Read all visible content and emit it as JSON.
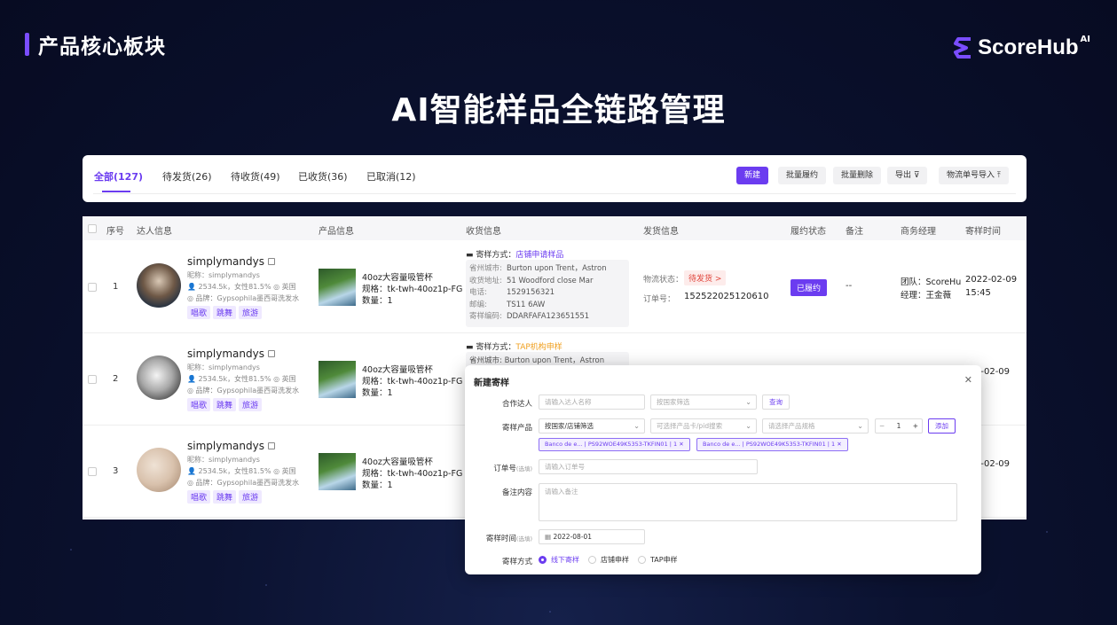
{
  "section_title": "产品核心板块",
  "brand": {
    "name": "ScoreHub",
    "ai": "AI",
    "accent": "#7a4dff"
  },
  "main_title": "AI智能样品全链路管理",
  "tabs": [
    {
      "label": "全部(127)",
      "active": true
    },
    {
      "label": "待发货(26)"
    },
    {
      "label": "待收货(49)"
    },
    {
      "label": "已收货(36)"
    },
    {
      "label": "已取消(12)"
    }
  ],
  "toolbar": {
    "new": "新建",
    "batch_fulfill": "批量履约",
    "batch_delete": "批量删除",
    "export": "导出",
    "import": "物流单号导入"
  },
  "columns": {
    "index": "序号",
    "influencer": "达人信息",
    "product": "产品信息",
    "receive": "收货信息",
    "ship": "发货信息",
    "status": "履约状态",
    "remark": "备注",
    "manager": "商务经理",
    "time": "寄样时间"
  },
  "rows": [
    {
      "index": "1",
      "name": "simplymandys",
      "nickname": "昵称：simplymandys",
      "stats": "2534.5k，女性81.5%",
      "country": "英国",
      "brand": "品牌：Gypsophila墨西哥洗发水",
      "tags": [
        "唱歌",
        "跳舞",
        "旅游"
      ],
      "product_name": "40oz大容量吸管杯",
      "product_spec": "规格：tk-twh-40oz1p-FG",
      "product_qty": "数量：1",
      "ship_method_label": "寄样方式：",
      "ship_method": "店铺申请样品",
      "address": [
        {
          "k": "省州城市:",
          "v": "Burton upon Trent，Astron"
        },
        {
          "k": "收货地址:",
          "v": "51 Woodford close Mar"
        },
        {
          "k": "电话:",
          "v": "1529156321"
        },
        {
          "k": "邮编:",
          "v": "TS11 6AW"
        },
        {
          "k": "寄样编码:",
          "v": "DDARFAFA123651551"
        }
      ],
      "logistics_label": "物流状态：",
      "logistics_status": "待发货 >",
      "order_label": "订单号：",
      "order_no": "152522025120610",
      "fulfill": "已履约",
      "remark": "--",
      "team": "团队：ScoreHu",
      "manager": "经理：王金薇",
      "date": "2022-02-09",
      "clock": "15:45"
    },
    {
      "index": "2",
      "name": "simplymandys",
      "nickname": "昵称：simplymandys",
      "stats": "2534.5k，女性81.5%",
      "country": "英国",
      "brand": "品牌：Gypsophila墨西哥洗发水",
      "tags": [
        "唱歌",
        "跳舞",
        "旅游"
      ],
      "product_name": "40oz大容量吸管杯",
      "product_spec": "规格：tk-twh-40oz1p-FG",
      "product_qty": "数量：1",
      "ship_method_label": "寄样方式：",
      "ship_method": "TAP机构申样",
      "address_first": "省州城市:  Burton upon Trent，Astron",
      "date": "2-02-09",
      "clock": "5"
    },
    {
      "index": "3",
      "name": "simplymandys",
      "nickname": "昵称：simplymandys",
      "stats": "2534.5k，女性81.5%",
      "country": "英国",
      "brand": "品牌：Gypsophila墨西哥洗发水",
      "tags": [
        "唱歌",
        "跳舞",
        "旅游"
      ],
      "product_name": "40oz大容量吸管杯",
      "product_spec": "规格：tk-twh-40oz1p-FG",
      "product_qty": "数量：1",
      "date": "2-02-09",
      "clock": "5"
    }
  ],
  "modal": {
    "title": "新建寄样",
    "partner_label": "合作达人",
    "partner_placeholder": "请输入达人名称",
    "country_placeholder": "按国家筛选",
    "query": "查询",
    "product_label": "寄样产品",
    "filter_value": "按国家/店铺筛选",
    "card_placeholder": "可选择产品卡/pid搜索",
    "spec_placeholder": "请选择产品规格",
    "qty": "1",
    "add": "添加",
    "chips": [
      "Banco de e... | PS92WOE49K5353-TKFIN01 | 1",
      "Banco de e... | PS92WOE49K5353-TKFIN01 | 1"
    ],
    "order_label": "订单号",
    "optional": "(选填)",
    "order_placeholder": "请输入订单号",
    "remark_label": "备注内容",
    "remark_placeholder": "请输入备注",
    "time_label": "寄样时间",
    "time_value": "2022-08-01",
    "method_label": "寄样方式",
    "methods": [
      "线下寄样",
      "店铺申样",
      "TAP申样"
    ]
  }
}
